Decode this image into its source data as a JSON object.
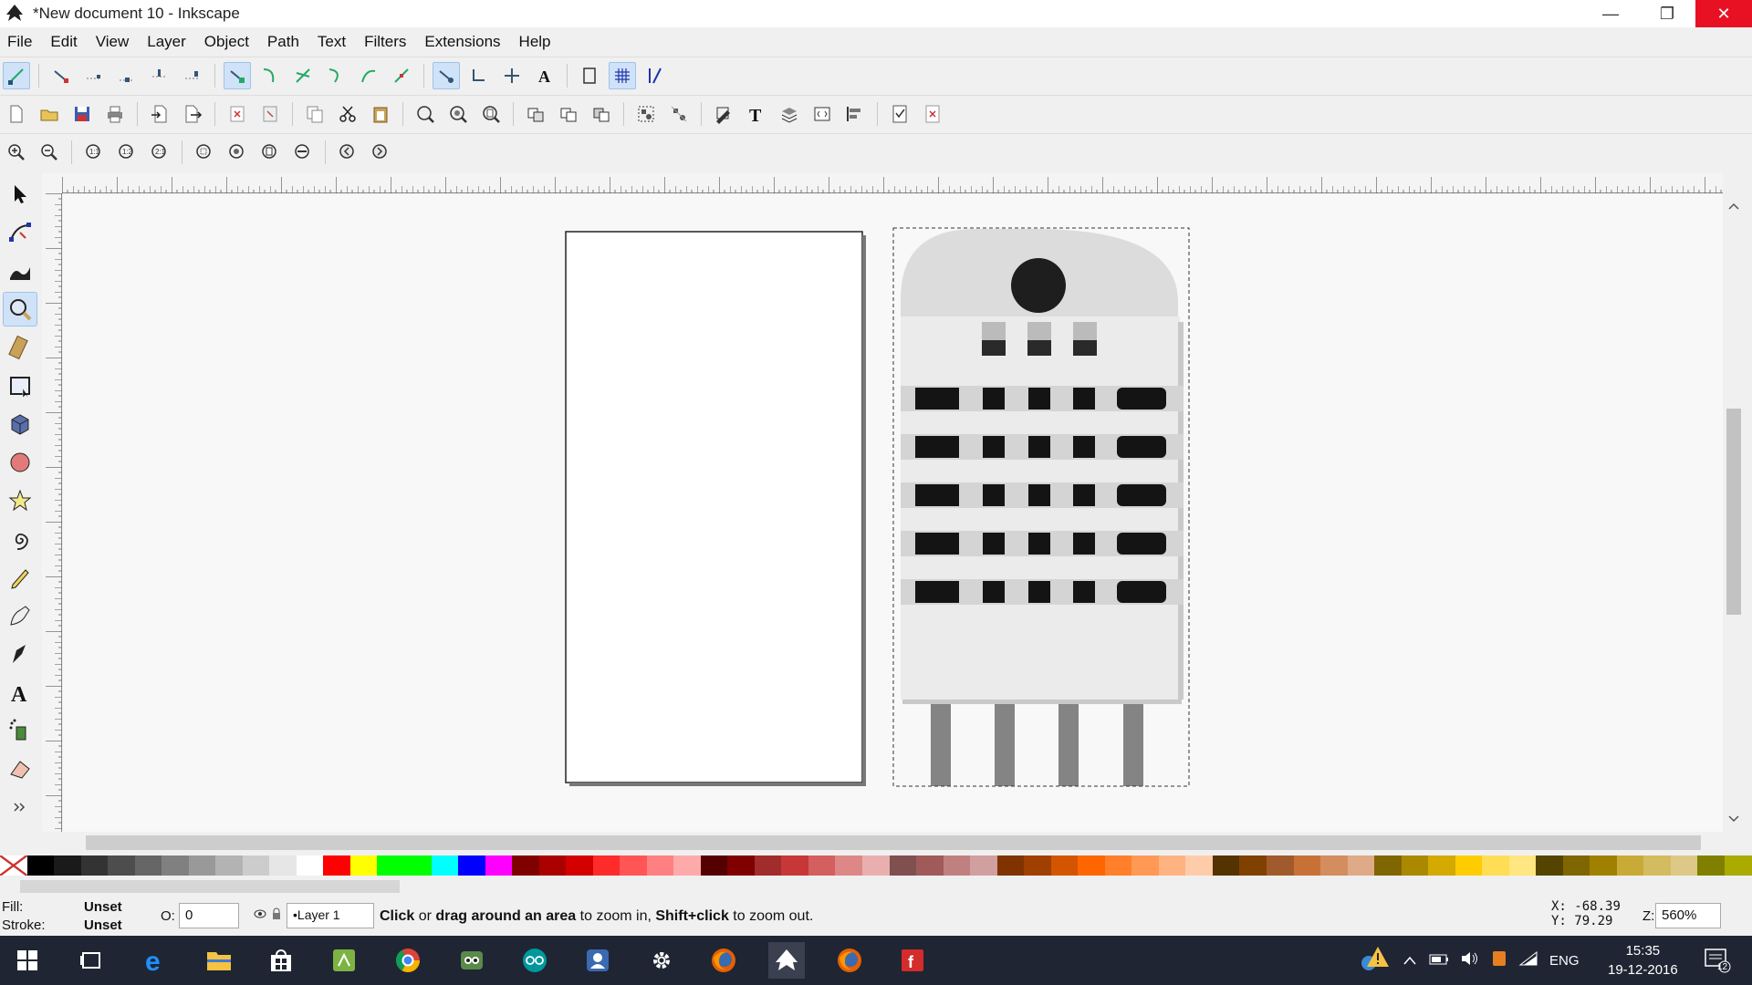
{
  "window": {
    "title": "*New document 10 - Inkscape"
  },
  "menu": [
    "File",
    "Edit",
    "View",
    "Layer",
    "Object",
    "Path",
    "Text",
    "Filters",
    "Extensions",
    "Help"
  ],
  "status": {
    "fill_label": "Fill:",
    "fill_value": "Unset",
    "stroke_label": "Stroke:",
    "stroke_value": "Unset",
    "opacity_label": "O:",
    "opacity_value": "0",
    "layer": "•Layer 1",
    "message_parts": [
      "Click",
      " or ",
      "drag around an area",
      " to zoom in, ",
      "Shift+click",
      " to zoom out."
    ],
    "x_label": "X:",
    "x_value": "-68.39",
    "y_label": "Y:",
    "y_value": "79.29",
    "zoom_label": "Z:",
    "zoom_value": "560%"
  },
  "taskbar": {
    "language": "ENG",
    "time": "15:35",
    "date": "19-12-2016",
    "notification_count": "12"
  },
  "colors": {
    "palette": [
      "#000000",
      "#1a1a1a",
      "#333333",
      "#4d4d4d",
      "#666666",
      "#808080",
      "#999999",
      "#b3b3b3",
      "#cccccc",
      "#e6e6e6",
      "#ffffff",
      "#ff0000",
      "#ffff00",
      "#00ff00",
      "#00ff00",
      "#00ffff",
      "#0000ff",
      "#ff00ff",
      "#800000",
      "#aa0000",
      "#d40000",
      "#ff2a2a",
      "#ff5555",
      "#ff8080",
      "#ffaaaa",
      "#550000",
      "#800000",
      "#a02c2c",
      "#c83737",
      "#d35f5f",
      "#de8787",
      "#e9afaf",
      "#805050",
      "#a05a5a",
      "#c08080",
      "#d0a0a0",
      "#803300",
      "#a04000",
      "#d45500",
      "#ff6600",
      "#ff7f2a",
      "#ff9955",
      "#ffb380",
      "#ffccaa",
      "#553300",
      "#804000",
      "#a05a2c",
      "#c87137",
      "#d38d5f",
      "#deaa87",
      "#806600",
      "#aa8800",
      "#d4aa00",
      "#ffcc00",
      "#ffdd55",
      "#ffe680",
      "#554400",
      "#806600",
      "#a08000",
      "#c8ab37",
      "#d3bc5f",
      "#dec887",
      "#808000",
      "#aaaa00"
    ]
  }
}
